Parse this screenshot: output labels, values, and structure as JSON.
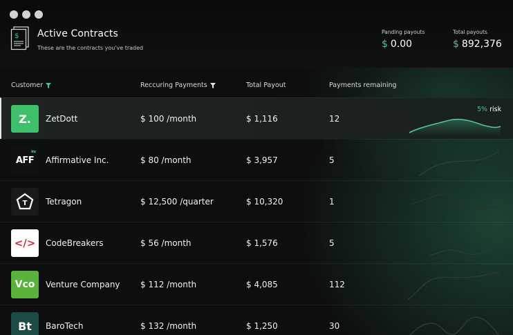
{
  "header": {
    "title": "Active Contracts",
    "subtitle": "These are the contracts you've traded",
    "pending": {
      "label": "Panding payouts",
      "currency": "$",
      "value": "0.00"
    },
    "total": {
      "label": "Total payouts",
      "currency": "$",
      "value": "892,376"
    }
  },
  "columns": {
    "customer": "Customer",
    "recurring": "Reccuring Payments",
    "total": "Total Payout",
    "remaining": "Payments remaining"
  },
  "colors": {
    "accent": "#4cc38a",
    "zetdott": "#3fbf6a",
    "affirmative": "#111111",
    "tetragon": "#1a1a1a",
    "codebreakers": "#ffffff",
    "venture": "#58b23c",
    "barotech": "#1c4a44"
  },
  "rows": [
    {
      "logo_text": "Z.",
      "logo_icon": "zetdott-logo",
      "name": "ZetDott",
      "recurring": "$ 100 /month",
      "total": "$ 1,116",
      "remaining": "12",
      "risk_pct": "5%",
      "risk_label": "risk"
    },
    {
      "logo_text": "AFF",
      "logo_sup": "Inc",
      "logo_icon": "affirmative-logo",
      "name": "Affirmative Inc.",
      "recurring": "$ 80 /month",
      "total": "$ 3,957",
      "remaining": "5"
    },
    {
      "logo_text": "T",
      "logo_icon": "tetragon-logo",
      "name": "Tetragon",
      "recurring": "$ 12,500 /quarter",
      "total": "$ 10,320",
      "remaining": "1"
    },
    {
      "logo_text": "</>",
      "logo_icon": "code-brackets-logo",
      "name": "CodeBreakers",
      "recurring": "$ 56 /month",
      "total": "$ 1,576",
      "remaining": "5"
    },
    {
      "logo_text": "Vco",
      "logo_icon": "venture-logo",
      "name": "Venture Company",
      "recurring": "$ 112 /month",
      "total": "$ 4,085",
      "remaining": "112"
    },
    {
      "logo_text": "Bt",
      "logo_icon": "barotech-logo",
      "name": "BaroTech",
      "recurring": "$ 132 /month",
      "total": "$ 1,250",
      "remaining": "30"
    }
  ]
}
